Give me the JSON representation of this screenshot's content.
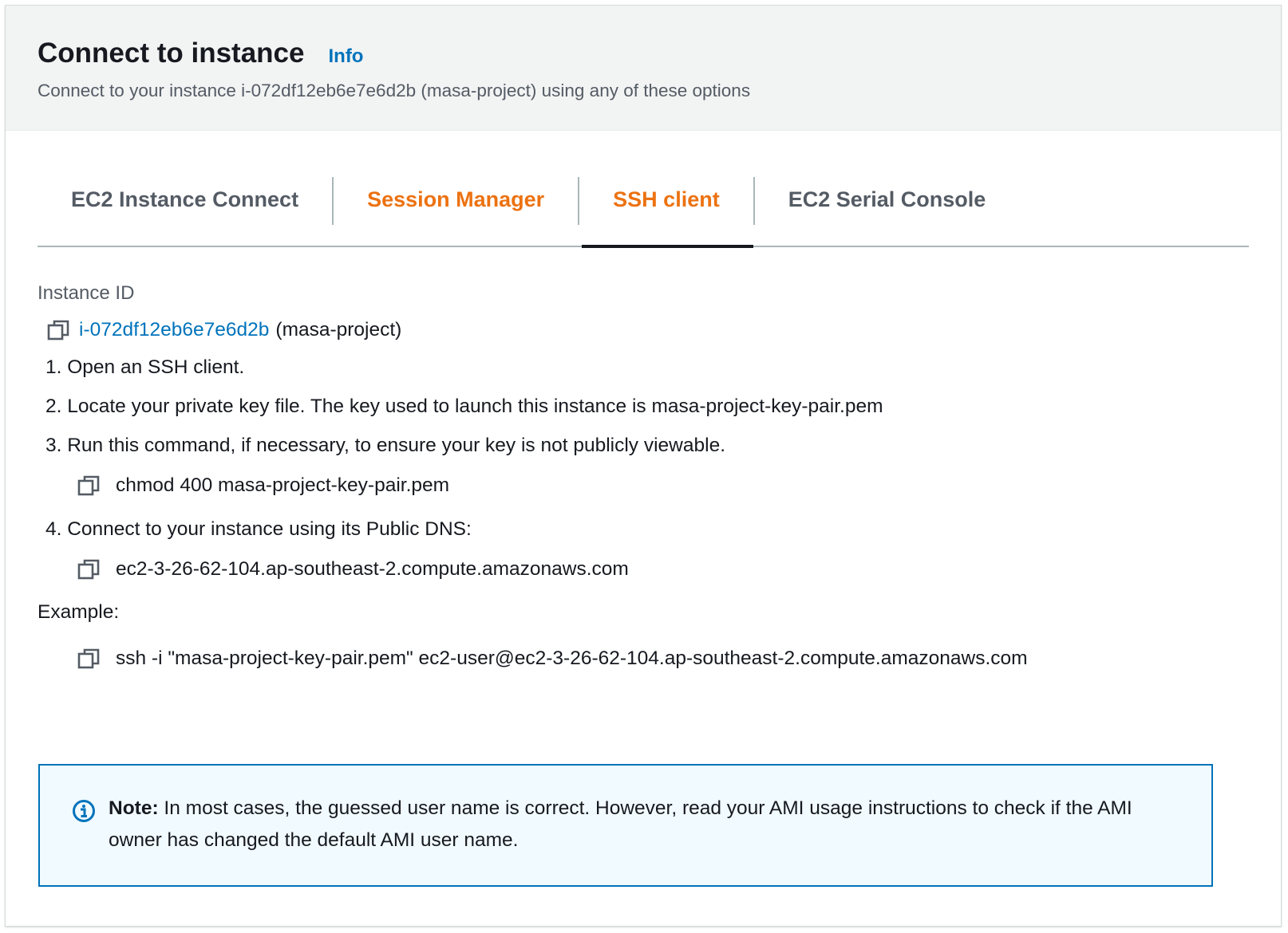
{
  "header": {
    "title": "Connect to instance",
    "info_label": "Info",
    "subtitle": "Connect to your instance i-072df12eb6e7e6d2b (masa-project) using any of these options"
  },
  "tabs": [
    {
      "label": "EC2 Instance Connect"
    },
    {
      "label": "Session Manager"
    },
    {
      "label": "SSH client"
    },
    {
      "label": "EC2 Serial Console"
    }
  ],
  "instance": {
    "label": "Instance ID",
    "id": "i-072df12eb6e7e6d2b",
    "name": "(masa-project)"
  },
  "steps": {
    "s1": "1. Open an SSH client.",
    "s2": "2. Locate your private key file. The key used to launch this instance is masa-project-key-pair.pem",
    "s3": "3. Run this command, if necessary, to ensure your key is not publicly viewable.",
    "s3_cmd": "chmod 400 masa-project-key-pair.pem",
    "s4": "4. Connect to your instance using its Public DNS:",
    "s4_dns": "ec2-3-26-62-104.ap-southeast-2.compute.amazonaws.com"
  },
  "example": {
    "label": "Example:",
    "cmd": "ssh -i \"masa-project-key-pair.pem\" ec2-user@ec2-3-26-62-104.ap-southeast-2.compute.amazonaws.com"
  },
  "note": {
    "bold": "Note:",
    "text": " In most cases, the guessed user name is correct. However, read your AMI usage instructions to check if the AMI owner has changed the default AMI user name."
  },
  "colors": {
    "accent_orange": "#ec7211",
    "link_blue": "#0073bb",
    "note_bg": "#f1faff"
  },
  "icons": {
    "copy": "copy-icon",
    "info": "info-circle-icon"
  }
}
